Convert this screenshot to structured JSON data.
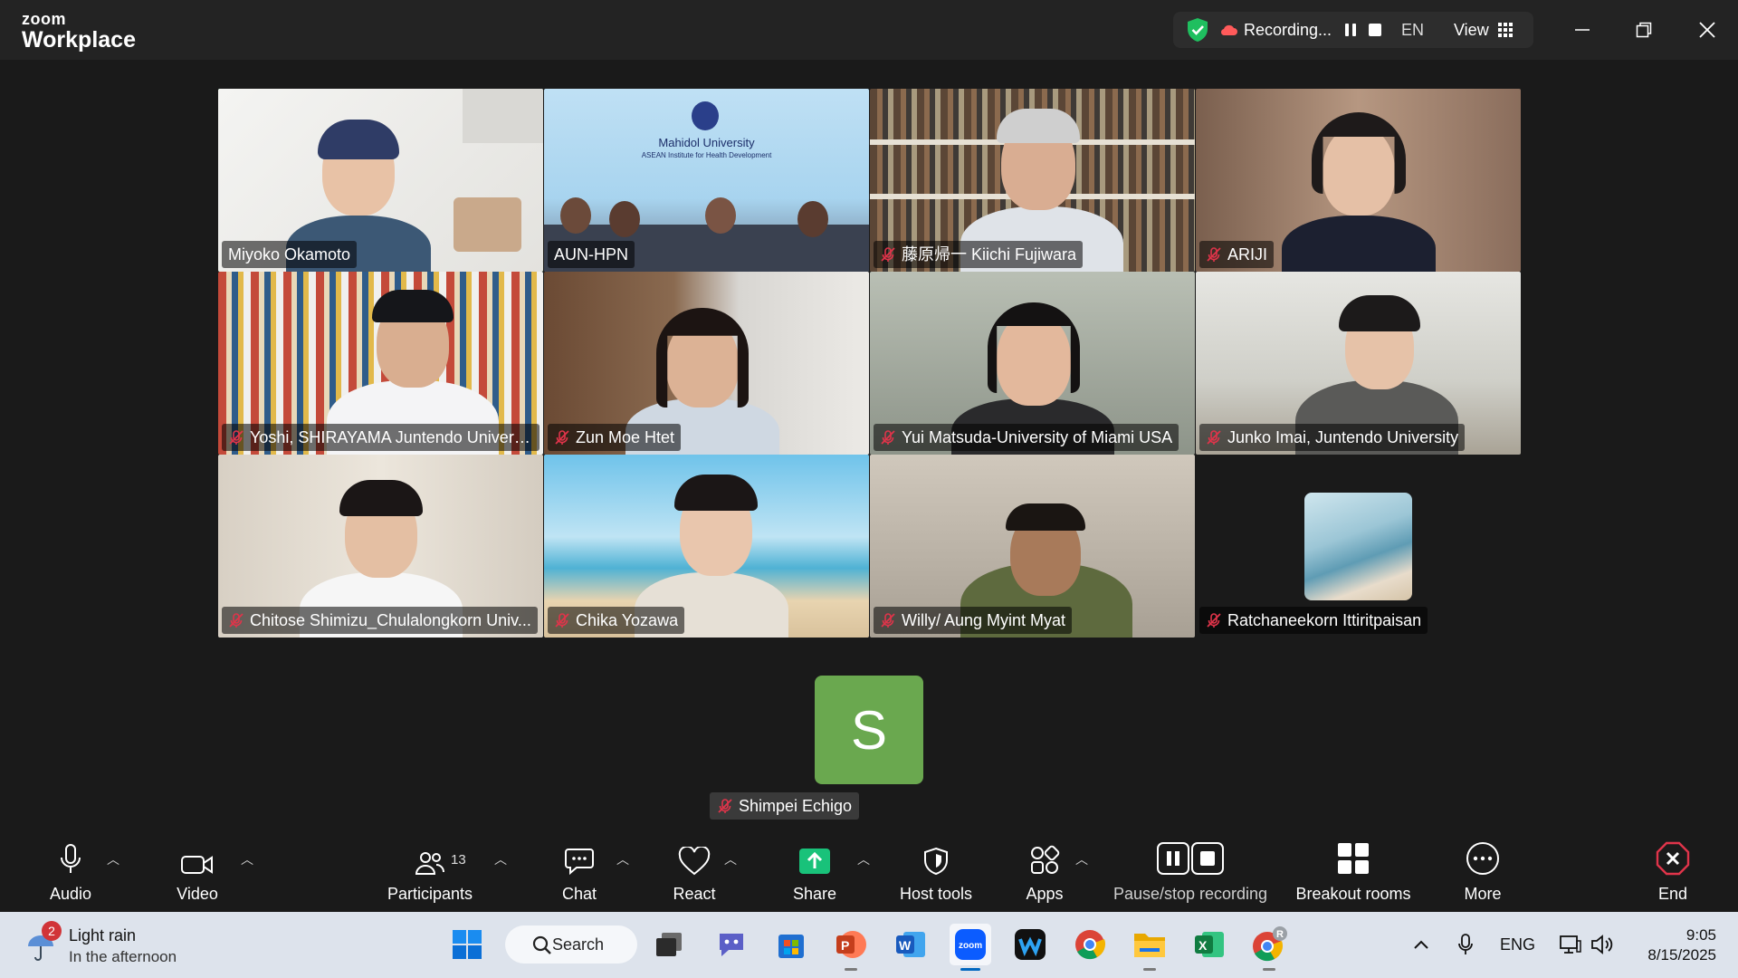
{
  "app": {
    "logo_line1": "zoom",
    "logo_line2": "Workplace"
  },
  "recording": {
    "status": "Recording...",
    "language": "EN",
    "view_label": "View"
  },
  "participants_tiles": [
    {
      "name": "Miyoko Okamoto",
      "muted": false,
      "speaking": true
    },
    {
      "name": "AUN-HPN",
      "muted": false,
      "banner_title": "Mahidol University",
      "banner_sub": "ASEAN Institute for Health Development"
    },
    {
      "name": "藤原帰一 Kiichi Fujiwara",
      "muted": true
    },
    {
      "name": "ARIJI",
      "muted": true
    },
    {
      "name": "Yoshi, SHIRAYAMA Juntendo Universi...",
      "muted": true
    },
    {
      "name": "Zun Moe Htet",
      "muted": true
    },
    {
      "name": "Yui Matsuda-University of Miami USA",
      "muted": true
    },
    {
      "name": "Junko Imai, Juntendo University",
      "muted": true
    },
    {
      "name": "Chitose Shimizu_Chulalongkorn Univ...",
      "muted": true
    },
    {
      "name": "Chika Yozawa",
      "muted": true
    },
    {
      "name": "Willy/ Aung Myint Myat",
      "muted": true
    },
    {
      "name": "Ratchaneekorn Ittiritpaisan",
      "muted": true
    }
  ],
  "avatar_only": {
    "initial": "S",
    "name": "Shimpei Echigo",
    "muted": true
  },
  "toolbar": {
    "audio": "Audio",
    "video": "Video",
    "participants": "Participants",
    "participants_count": "13",
    "chat": "Chat",
    "react": "React",
    "share": "Share",
    "host_tools": "Host tools",
    "apps": "Apps",
    "pause_stop": "Pause/stop recording",
    "breakout": "Breakout rooms",
    "more": "More",
    "end": "End"
  },
  "taskbar": {
    "weather_badge": "2",
    "weather_title": "Light rain",
    "weather_sub": "In the afternoon",
    "search": "Search",
    "lang": "ENG",
    "time": "9:05",
    "date": "8/15/2025",
    "chrome_profile": "R",
    "zoom_label": "zoom"
  },
  "colors": {
    "accent_green": "#3fd97b",
    "share_green": "#19c27a",
    "end_red": "#e0344a",
    "avatar_green": "#6aa84f"
  }
}
